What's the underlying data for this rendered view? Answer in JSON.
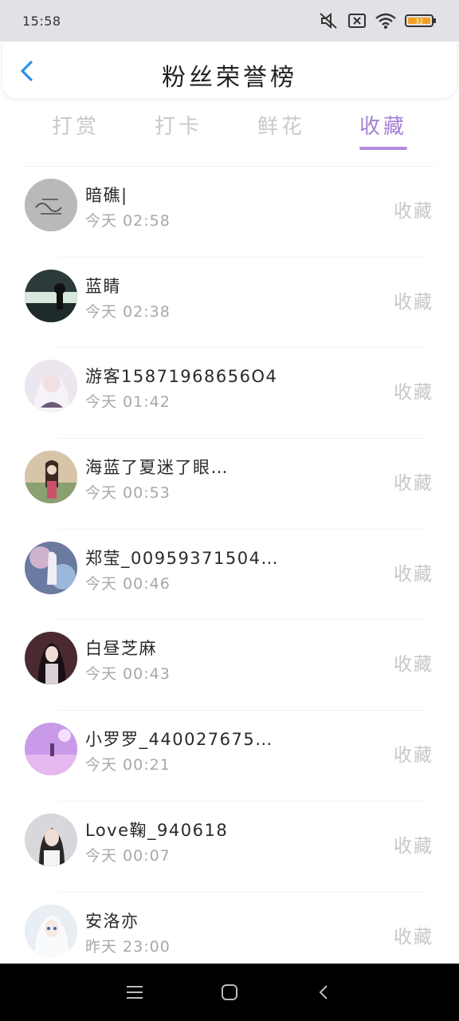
{
  "status_bar": {
    "time": "15:58",
    "battery": "32"
  },
  "header": {
    "title": "粉丝荣誉榜"
  },
  "tabs": [
    {
      "label": "打赏",
      "active": false
    },
    {
      "label": "打卡",
      "active": false
    },
    {
      "label": "鲜花",
      "active": false
    },
    {
      "label": "收藏",
      "active": true
    }
  ],
  "fans": [
    {
      "name": "暗礁|",
      "time": "今天 02:58",
      "action": "收藏"
    },
    {
      "name": "蓝睛",
      "time": "今天 02:38",
      "action": "收藏"
    },
    {
      "name": "游客15871968656O4",
      "time": "今天 01:42",
      "action": "收藏"
    },
    {
      "name": "海蓝了夏迷了眼…",
      "time": "今天 00:53",
      "action": "收藏"
    },
    {
      "name": "郑莹_00959371504…",
      "time": "今天 00:46",
      "action": "收藏"
    },
    {
      "name": "白昼芝麻",
      "time": "今天 00:43",
      "action": "收藏"
    },
    {
      "name": "小罗罗_440027675…",
      "time": "今天 00:21",
      "action": "收藏"
    },
    {
      "name": "Love鞠_940618",
      "time": "今天 00:07",
      "action": "收藏"
    },
    {
      "name": "安洛亦",
      "time": "昨天 23:00",
      "action": "收藏"
    }
  ],
  "colors": {
    "accent": "#a580d6",
    "muted": "#c8c8cc",
    "back_arrow": "#2f8fe6"
  }
}
